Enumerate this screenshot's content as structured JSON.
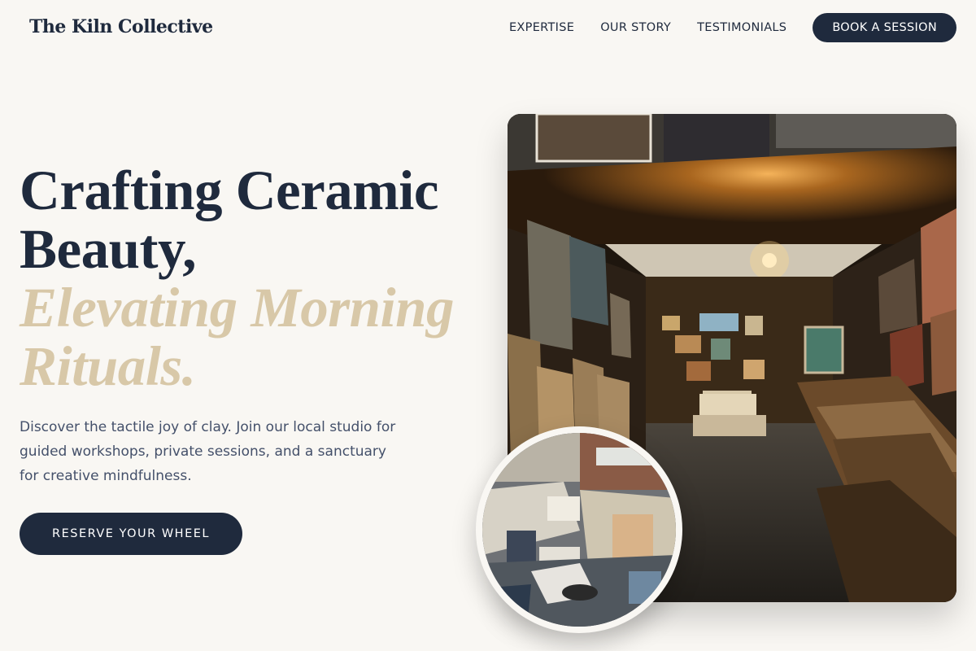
{
  "brand": {
    "name": "The Kiln Collective"
  },
  "nav": {
    "links": [
      "EXPERTISE",
      "OUR STORY",
      "TESTIMONIALS"
    ],
    "cta": "BOOK A SESSION"
  },
  "hero": {
    "headline_line1": "Crafting Ceramic",
    "headline_line2": "Beauty,",
    "headline_accent1": "Elevating Morning",
    "headline_accent2": "Rituals.",
    "description": "Discover the tactile joy of clay. Join our local studio for guided workshops, private sessions, and a sanctuary for creative mindfulness.",
    "cta": "RESERVE YOUR WHEEL"
  },
  "colors": {
    "primary": "#1f2a3d",
    "accent": "#d8c8a8",
    "background": "#f9f7f3",
    "body_text": "#44506a"
  }
}
